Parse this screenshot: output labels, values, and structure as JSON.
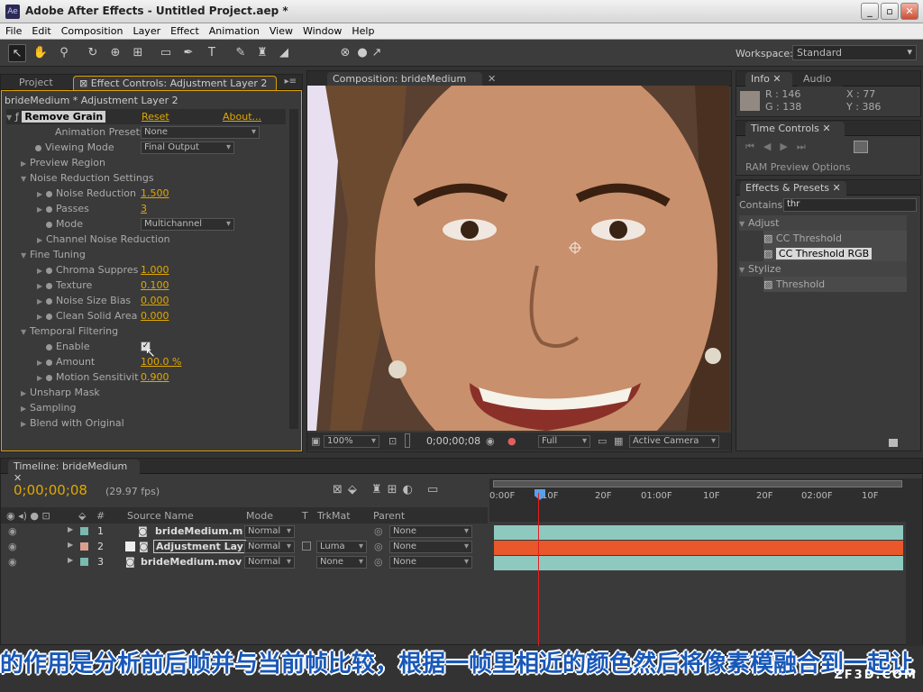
{
  "window": {
    "title": "Adobe After Effects - Untitled Project.aep *",
    "logo_text": "Ae"
  },
  "menu": [
    "File",
    "Edit",
    "Composition",
    "Layer",
    "Effect",
    "Animation",
    "View",
    "Window",
    "Help"
  ],
  "workspace": {
    "label": "Workspace:",
    "value": "Standard"
  },
  "project_tab": "Project",
  "effect_controls": {
    "tab": "Effect Controls: Adjustment Layer 2",
    "layer_path": "brideMedium * Adjustment Layer 2",
    "effect_name": "Remove Grain",
    "reset": "Reset",
    "about": "About...",
    "presets_label": "Animation Presets:",
    "presets_value": "None",
    "viewing_mode_label": "Viewing Mode",
    "viewing_mode_value": "Final Output",
    "preview_region": "Preview Region",
    "noise_reduction_settings": "Noise Reduction Settings",
    "noise_reduction_label": "Noise Reduction",
    "noise_reduction_value": "1.500",
    "passes_label": "Passes",
    "passes_value": "3",
    "mode_label": "Mode",
    "mode_value": "Multichannel",
    "channel_noise": "Channel Noise Reduction",
    "fine_tuning": "Fine Tuning",
    "chroma_label": "Chroma Suppres",
    "chroma_value": "1.000",
    "texture_label": "Texture",
    "texture_value": "0.100",
    "noise_size_label": "Noise Size Bias",
    "noise_size_value": "0.000",
    "clean_solid_label": "Clean Solid Area",
    "clean_solid_value": "0.000",
    "temporal_filtering": "Temporal Filtering",
    "enable_label": "Enable",
    "amount_label": "Amount",
    "amount_value": "100.0 %",
    "motion_label": "Motion Sensitivit",
    "motion_value": "0.900",
    "unsharp_mask": "Unsharp Mask",
    "sampling": "Sampling",
    "blend": "Blend with Original"
  },
  "composition": {
    "tab": "Composition: brideMedium",
    "zoom": "100%",
    "timecode": "0;00;00;08",
    "resolution": "Full",
    "camera": "Active Camera"
  },
  "info": {
    "tab": "Info",
    "audio_tab": "Audio",
    "r": "R : 146",
    "g": "G : 138",
    "x": "X : 77",
    "y": "Y : 386"
  },
  "time_controls": {
    "tab": "Time Controls",
    "ram_preview": "RAM Preview Options"
  },
  "effects_presets": {
    "tab": "Effects & Presets",
    "contains_label": "Contains:",
    "search_value": "thr",
    "groups": [
      {
        "name": "Adjust",
        "items": [
          "CC Threshold",
          "CC Threshold RGB"
        ]
      },
      {
        "name": "Stylize",
        "items": [
          "Threshold"
        ]
      }
    ]
  },
  "timeline": {
    "tab": "Timeline: brideMedium",
    "timecode": "0;00;00;08",
    "fps": "(29.97 fps)",
    "columns": {
      "num": "#",
      "source": "Source Name",
      "mode": "Mode",
      "t": "T",
      "trkmat": "TrkMat",
      "parent": "Parent"
    },
    "ruler": [
      "0:00F",
      "10F",
      "20F",
      "01:00F",
      "10F",
      "20F",
      "02:00F",
      "10F"
    ],
    "layers": [
      {
        "num": "1",
        "name": "brideMedium.m",
        "mode": "Normal",
        "trkmat": "",
        "parent": "None",
        "color": "#8ec9c0",
        "label": "#7ab8b0"
      },
      {
        "num": "2",
        "name": "Adjustment Lay",
        "mode": "Normal",
        "trkmat": "Luma",
        "parent": "None",
        "color": "#e8582a",
        "label": "#d8a090"
      },
      {
        "num": "3",
        "name": "brideMedium.mov",
        "mode": "Normal",
        "trkmat": "None",
        "parent": "None",
        "color": "#8ec9c0",
        "label": "#7ab8b0"
      }
    ]
  },
  "subtitle": "的作用是分析前后帧并与当前帧比较，根据一帧里相近的颜色然后将像素模融合到一起让",
  "watermark": "ZF3D.COM"
}
